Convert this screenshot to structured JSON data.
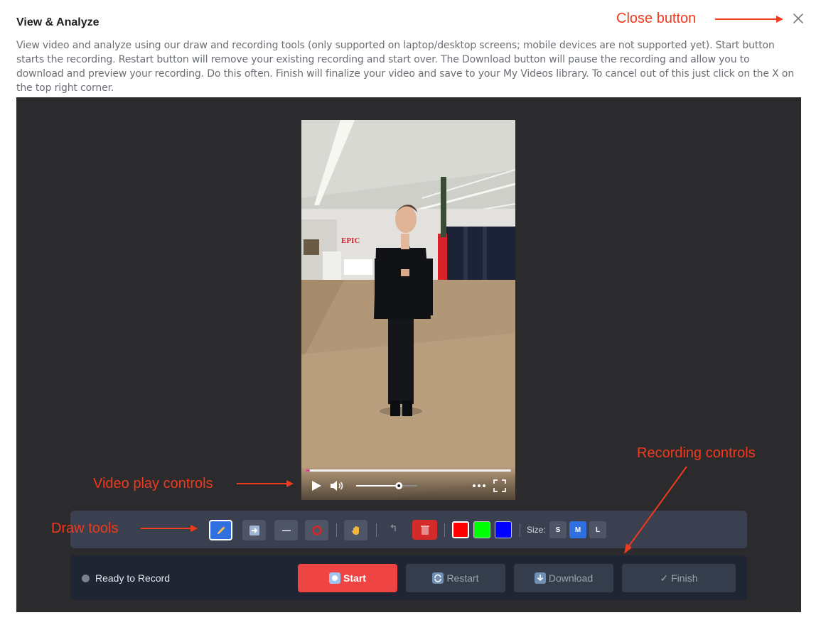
{
  "modal": {
    "title": "View & Analyze",
    "description": "View video and analyze using our draw and recording tools (only supported on laptop/desktop screens; mobile devices are not supported yet). Start button starts the recording. Restart button will remove your existing recording and start over. The Download button will pause the recording and allow you to download and preview your recording. Do this often. Finish will finalize your video and save to your My Videos library. To cancel out of this just click on the X on the top right corner.",
    "close_icon": "close-icon"
  },
  "annotations": {
    "close": "Close button",
    "video": "Video play controls",
    "draw": "Draw tools",
    "recording": "Recording controls",
    "color": "#ee3a1e"
  },
  "video": {
    "wall_sign": "EPIC",
    "progress_fraction": 0.02,
    "volume_fraction": 0.7,
    "icons": [
      "play-icon",
      "volume-icon",
      "more-icon",
      "fullscreen-icon"
    ]
  },
  "draw_tools": {
    "tools": [
      "pencil-icon",
      "arrow-icon",
      "line-icon",
      "circle-icon",
      "hand-icon",
      "undo-icon",
      "trash-icon"
    ],
    "active_tool": "pencil-icon",
    "colors": [
      "#ff0000",
      "#00ff00",
      "#0000ff"
    ],
    "active_color": "#ff0000",
    "size_label": "Size:",
    "sizes": [
      "S",
      "M",
      "L"
    ],
    "active_size": "M"
  },
  "recording": {
    "status": "Ready to Record",
    "start_label": "Start",
    "restart_label": "Restart",
    "download_label": "Download",
    "finish_label": "✓ Finish"
  }
}
